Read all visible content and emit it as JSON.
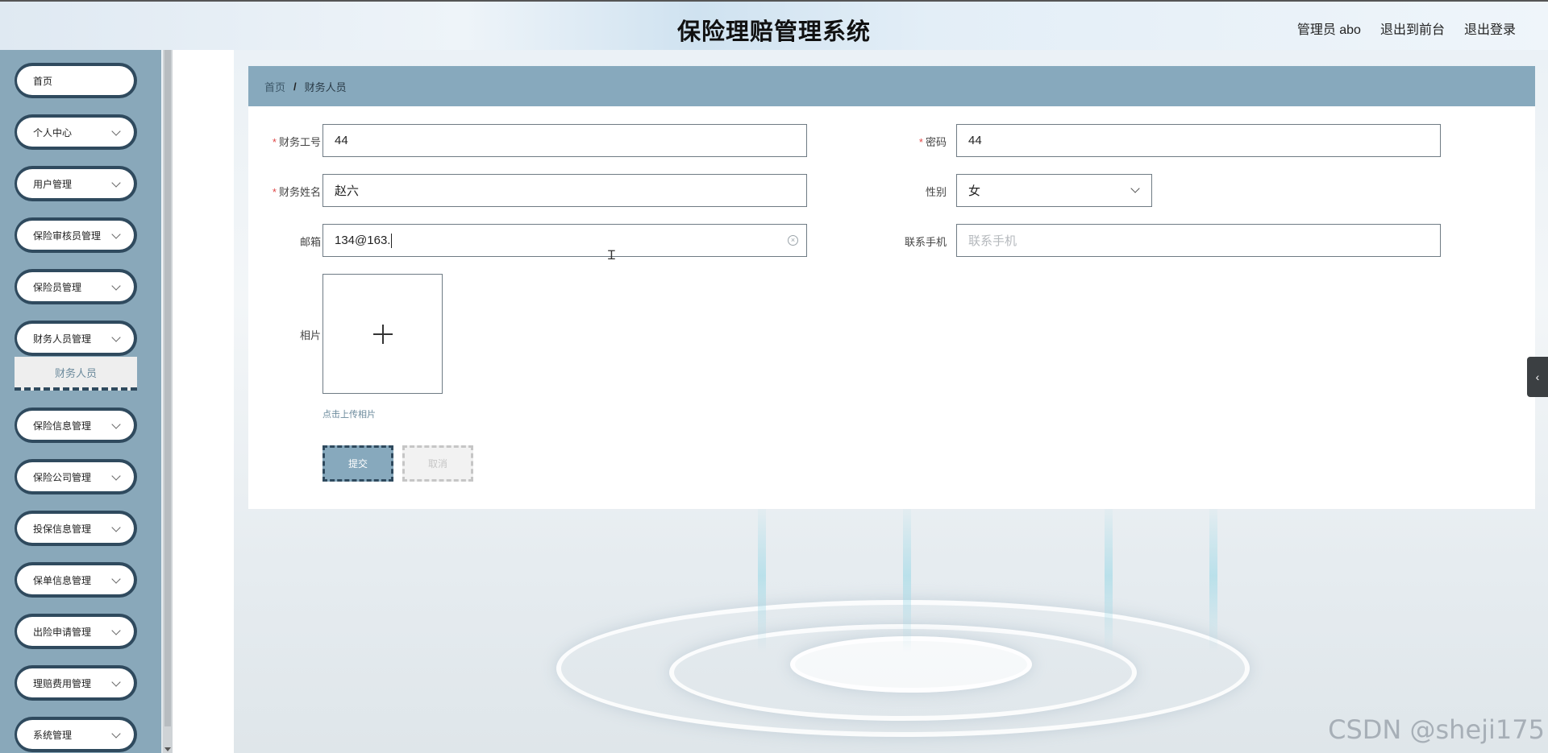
{
  "header": {
    "title": "保险理赔管理系统",
    "admin": "管理员 abo",
    "to_front": "退出到前台",
    "logout": "退出登录"
  },
  "sidebar": {
    "items": [
      {
        "label": "首页",
        "has_arrow": false
      },
      {
        "label": "个人中心",
        "has_arrow": true
      },
      {
        "label": "用户管理",
        "has_arrow": true
      },
      {
        "label": "保险审核员管理",
        "has_arrow": true
      },
      {
        "label": "保险员管理",
        "has_arrow": true
      },
      {
        "label": "财务人员管理",
        "has_arrow": true
      },
      {
        "label": "保险信息管理",
        "has_arrow": true
      },
      {
        "label": "保险公司管理",
        "has_arrow": true
      },
      {
        "label": "投保信息管理",
        "has_arrow": true
      },
      {
        "label": "保单信息管理",
        "has_arrow": true
      },
      {
        "label": "出险申请管理",
        "has_arrow": true
      },
      {
        "label": "理赔费用管理",
        "has_arrow": true
      },
      {
        "label": "系统管理",
        "has_arrow": true
      }
    ],
    "active_sub": "财务人员"
  },
  "breadcrumb": {
    "home": "首页",
    "separator": "/",
    "current": "财务人员"
  },
  "form": {
    "staff_no": {
      "label": "财务工号",
      "value": "44",
      "required": true
    },
    "password": {
      "label": "密码",
      "value": "44",
      "required": true
    },
    "staff_name": {
      "label": "财务姓名",
      "value": "赵六",
      "required": true
    },
    "gender": {
      "label": "性别",
      "value": "女"
    },
    "email": {
      "label": "邮箱",
      "value": "134@163."
    },
    "phone": {
      "label": "联系手机",
      "value": "",
      "placeholder": "联系手机"
    },
    "photo": {
      "label": "相片",
      "tip": "点击上传相片"
    },
    "submit": "提交",
    "cancel": "取消"
  },
  "misc": {
    "side_tab": "‹",
    "watermark": "CSDN @sheji175"
  },
  "colors": {
    "sidebar_bg": "#89a8ba",
    "accent_dark": "#2f4a5e",
    "breadcrumb_bg": "#87a9bd",
    "required": "#e04848"
  }
}
